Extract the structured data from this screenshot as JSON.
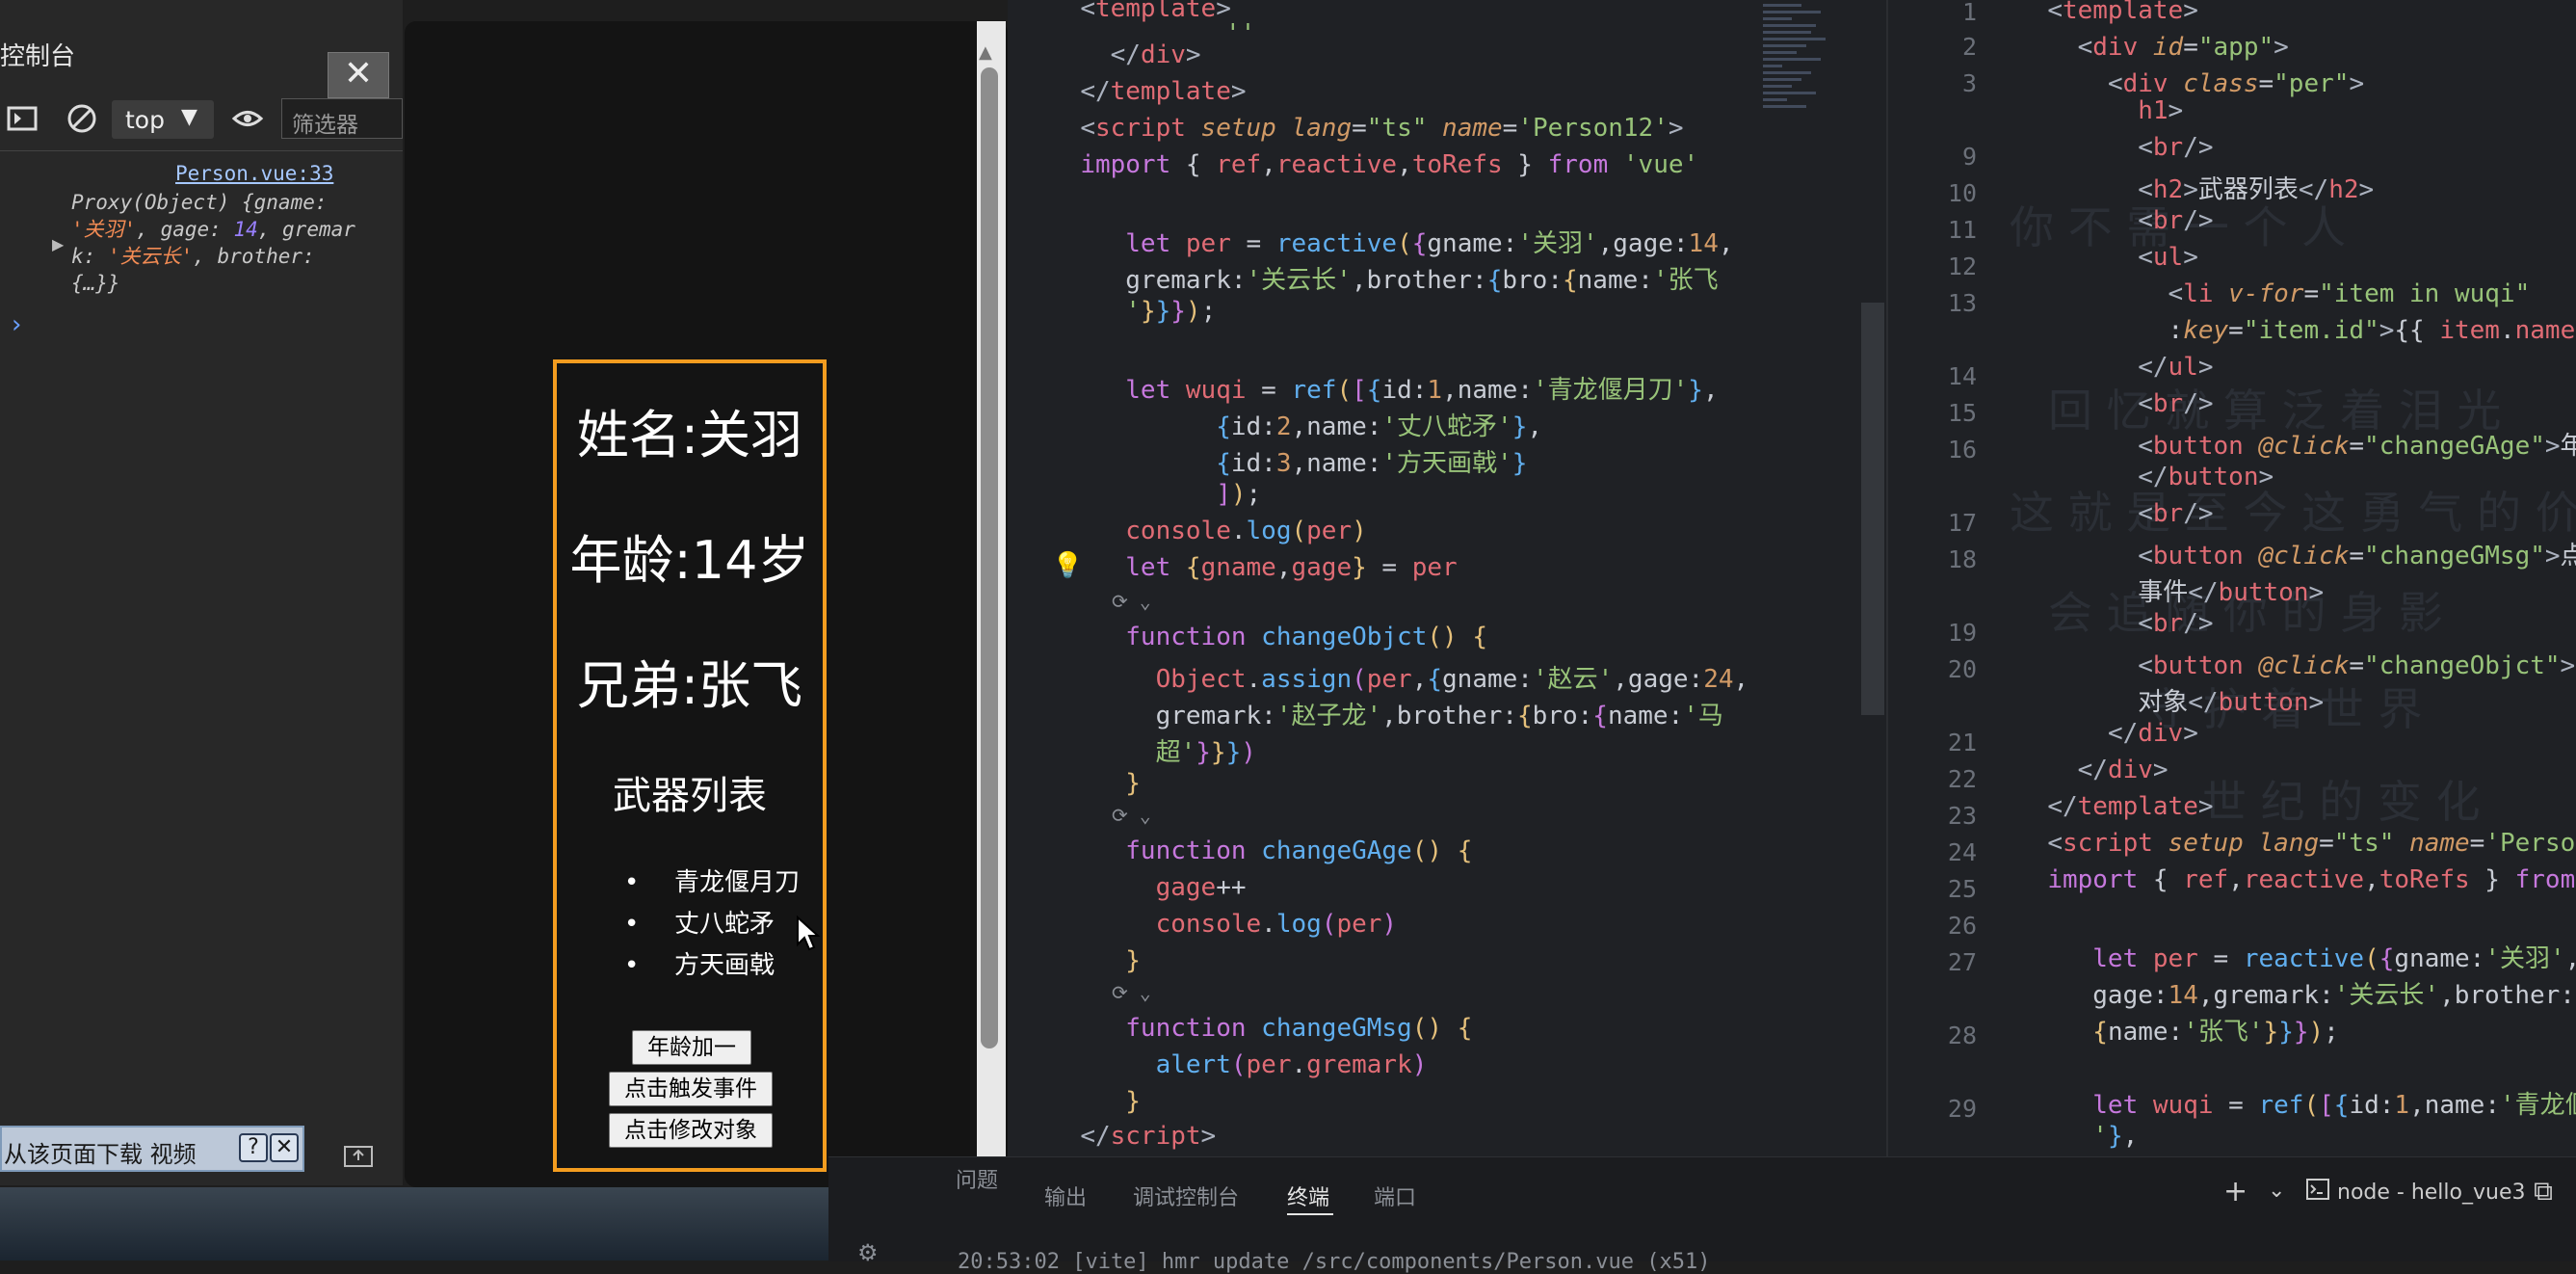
{
  "devtools": {
    "title": "控制台",
    "close_glyph": "✕",
    "context": "top",
    "context_arrow": "▼",
    "filter_placeholder": "筛选器",
    "source_link": "Person.vue:33",
    "log_prefix": "Proxy(Object) {gname: ",
    "log_gname": "'关羽'",
    "log_mid1": ", gage: ",
    "log_gage": "14",
    "log_mid2": ", gremark: ",
    "log_gremark": "'关云长'",
    "log_tail": ", brother: {…}}",
    "prompt": "›",
    "download_bar": {
      "text": "从该页面下载 视频",
      "help": "?",
      "close": "✕"
    }
  },
  "preview": {
    "name": "姓名:关羽",
    "age": "年龄:14岁",
    "brother": "兄弟:张飞",
    "list_title": "武器列表",
    "weapons": [
      "青龙偃月刀",
      "丈八蛇矛",
      "方天画戟"
    ],
    "buttons": {
      "age_plus": "年龄加一",
      "trigger_event": "点击触发事件",
      "modify_object": "点击修改对象"
    }
  },
  "editor": {
    "codelens": "⟳ ⌄",
    "right_line_numbers": [
      "1",
      "2",
      "3",
      "9",
      "10",
      "11",
      "12",
      "13",
      "14",
      "15",
      "16",
      "17",
      "18",
      "19",
      "20",
      "21",
      "22",
      "23",
      "24",
      "25",
      "26",
      "27",
      "28",
      "29"
    ]
  },
  "panel": {
    "tabs": [
      "问题",
      "输出",
      "调试控制台",
      "终端",
      "端口"
    ],
    "active_tab": "终端",
    "terminal_name": "node - hello_vue3",
    "terminal_line": "20:53:02 [vite] hmr update /src/components/Person.vue (x51)",
    "add_glyph": "+",
    "split_glyph": "⧉"
  },
  "colors": {
    "card_border": "#f39c1f",
    "editor_bg": "#1f2125",
    "devtools_bg": "#282828"
  }
}
